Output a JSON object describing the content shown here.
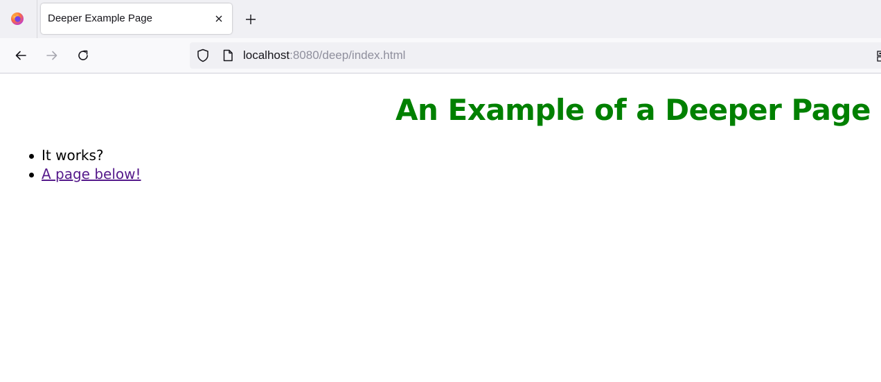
{
  "browser": {
    "tab": {
      "title": "Deeper Example Page"
    },
    "url": {
      "host": "localhost",
      "rest": ":8080/deep/index.html"
    }
  },
  "page": {
    "heading": "An Example of a Deeper Page",
    "heading_color": "#008000",
    "list_items": {
      "item1": "It works?",
      "item2_link": "A page below!"
    },
    "link_color": "#551a8b"
  },
  "icons": {
    "app": "firefox-icon",
    "tab_close": "close-icon",
    "new_tab": "plus-icon",
    "back": "back-arrow-icon",
    "forward": "forward-arrow-icon",
    "reload": "reload-icon",
    "tracking": "shield-icon",
    "page": "page-icon",
    "url_right": "qr-code-icon"
  }
}
